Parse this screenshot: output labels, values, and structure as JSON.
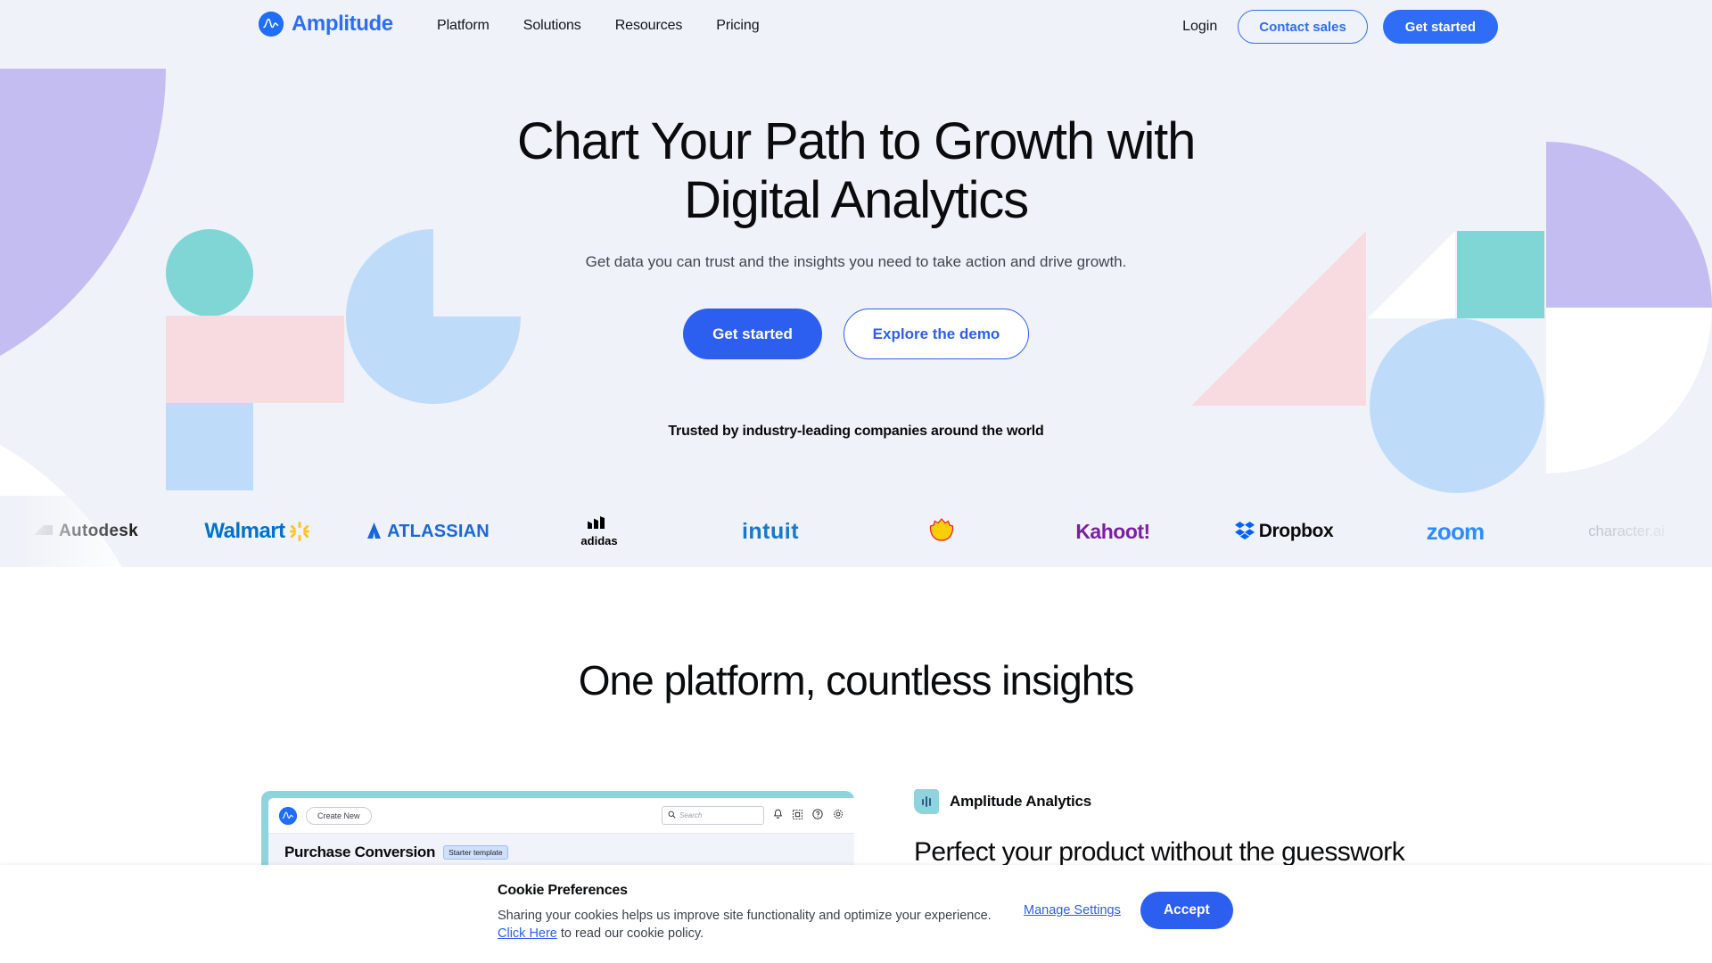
{
  "header": {
    "brand": {
      "name": "Amplitude",
      "mark_icon": "amplitude-logo-icon"
    },
    "nav": [
      {
        "label": "Platform"
      },
      {
        "label": "Solutions"
      },
      {
        "label": "Resources"
      },
      {
        "label": "Pricing"
      }
    ],
    "login_label": "Login",
    "contact_sales_label": "Contact sales",
    "get_started_label": "Get started",
    "accent_color": "#2f6df6"
  },
  "hero": {
    "title_line1": "Chart Your Path to Growth with",
    "title_line2": "Digital Analytics",
    "subtitle": "Get data you can trust and the insights you need to take action and drive growth.",
    "cta_primary": "Get started",
    "cta_secondary": "Explore the demo",
    "trusted_label": "Trusted by industry-leading companies around the world",
    "logos": [
      {
        "name": "Autodesk",
        "key": "autodesk"
      },
      {
        "name": "Walmart",
        "key": "walmart"
      },
      {
        "name": "ATLASSIAN",
        "key": "atlassian"
      },
      {
        "name": "adidas",
        "key": "adidas"
      },
      {
        "name": "intuit",
        "key": "intuit"
      },
      {
        "name": "Shell",
        "key": "shell"
      },
      {
        "name": "Kahoot!",
        "key": "kahoot"
      },
      {
        "name": "Dropbox",
        "key": "dropbox"
      },
      {
        "name": "zoom",
        "key": "zoom"
      },
      {
        "name": "character.ai",
        "key": "character"
      }
    ],
    "background_colors": {
      "page": "#eff2f8",
      "purple": "#c3bdf2",
      "teal": "#7fd6d5",
      "pink": "#f8dbe0",
      "blue": "#bedcfa",
      "white": "#ffffff"
    }
  },
  "section2": {
    "title": "One platform, countless insights",
    "product_card": {
      "frame_color": "#8ed3dd",
      "create_new_label": "Create New",
      "search_placeholder": "Search",
      "page_title": "Purchase Conversion",
      "badge_label": "Starter template",
      "icons": [
        "bell-icon",
        "dashboard-icon",
        "help-icon",
        "gear-icon"
      ]
    },
    "feature": {
      "badge_label": "Amplitude Analytics",
      "badge_icon": "bar-chart-icon",
      "badge_color": "#8ed3dd",
      "heading": "Perfect your product without the guesswork"
    }
  },
  "cookie_banner": {
    "title": "Cookie Preferences",
    "text_line1": "Sharing your cookies helps us improve site functionality and optimize your experience.",
    "link_label": "Click Here",
    "text_line2": " to read our cookie policy.",
    "manage_label": "Manage Settings",
    "accept_label": "Accept",
    "accent_color": "#2c5ff0"
  }
}
